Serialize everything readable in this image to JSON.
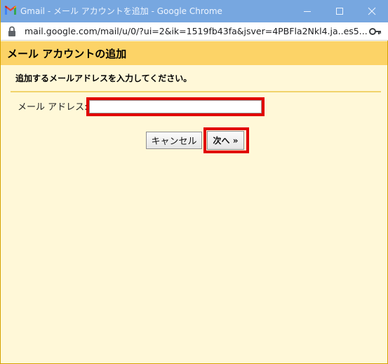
{
  "window": {
    "title": "Gmail - メール アカウントを追加 - Google Chrome",
    "url": "mail.google.com/mail/u/0/?ui=2&ik=1519fb43fa&jsver=4PBFla2Nkl4.ja..es5...",
    "minimize_icon": "minimize-icon",
    "maximize_icon": "maximize-icon",
    "close_icon": "close-icon",
    "lock_icon": "lock-icon",
    "key_icon": "key-icon",
    "app_icon": "gmail-icon"
  },
  "dialog": {
    "title": "メール アカウントの追加",
    "instruction": "追加するメールアドレスを入力してください。",
    "email_label": "メール アドレス:",
    "email_value": "",
    "cancel_label": "キャンセル",
    "next_label": "次へ »"
  },
  "colors": {
    "titlebar": "#77a7e0",
    "dialog_header": "#fcd367",
    "dialog_background": "#fff8d8",
    "highlight": "#e10000"
  }
}
